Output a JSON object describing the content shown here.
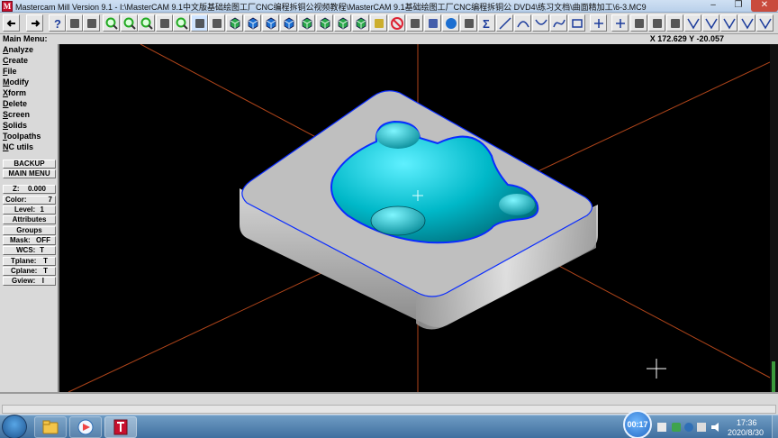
{
  "window": {
    "title": "Mastercam Mill Version 9.1 - I:\\MasterCAM 9.1中文版基础绘图工厂CNC编程拆铜公视频教程\\MasterCAM 9.1基础绘图工厂CNC编程拆铜公 DVD4\\练习文档\\曲面精加工\\6-3.MC9",
    "icon_glyph": "M",
    "min_glyph": "–",
    "max_glyph": "❐",
    "close_glyph": "✕"
  },
  "toolbar": {
    "buttons": [
      "arrow-left-icon",
      "arrow-right-icon",
      "help-icon",
      "calculator-icon",
      "analyze-icon",
      "zoom-in-icon",
      "zoom-out-icon",
      "zoom-window-icon",
      "pan-icon",
      "zoom-fit-icon",
      "select-icon",
      "repaint-icon",
      "view-top-icon",
      "view-front-icon",
      "view-side-icon",
      "view-iso-icon",
      "cube-view1-icon",
      "cube-view2-icon",
      "cube-view3-icon",
      "cube-view4-icon",
      "pencil-icon",
      "no-entry-icon",
      "draw-icon",
      "undo-icon",
      "sphere-icon",
      "chain-icon",
      "sigma-icon",
      "line-icon",
      "arc-icon",
      "curve-icon",
      "spline-icon",
      "rectangle-icon",
      "point-icon",
      "plus-icon",
      "transform-icon",
      "toolpath-icon",
      "verify-icon",
      "x-cut-icon",
      "chamfer-icon",
      "y-cut-icon",
      "v-cut-icon",
      "trim-icon"
    ]
  },
  "status": {
    "main_menu_label": "Main Menu:",
    "coordinates": "X 172.629   Y -20.057"
  },
  "main_menu": {
    "items": [
      "Analyze",
      "Create",
      "File",
      "Modify",
      "Xform",
      "Delete",
      "Screen",
      "Solids",
      "Toolpaths",
      "NC utils"
    ]
  },
  "panel": {
    "backup": "BACKUP",
    "main_menu": "MAIN MENU",
    "z_label": "Z:",
    "z_value": "0.000",
    "color_label": "Color:",
    "color_value": "7",
    "level_label": "Level:",
    "level_value": "1",
    "attributes": "Attributes",
    "groups": "Groups",
    "mask_label": "Mask:",
    "mask_value": "OFF",
    "wcs_label": "WCS:",
    "wcs_value": "T",
    "tplane_label": "Tplane:",
    "tplane_value": "T",
    "cplane_label": "Cplane:",
    "cplane_value": "T",
    "gview_label": "Gview:",
    "gview_value": "I"
  },
  "colors": {
    "axis_lines": "#b0451a",
    "part_gray": "#bfbfbf",
    "cavity_cyan": "#00b8c8",
    "outline_blue": "#0a2cff"
  },
  "taskbar": {
    "recording_badge": "00:17",
    "time": "17:36",
    "date": "2020/8/30"
  }
}
